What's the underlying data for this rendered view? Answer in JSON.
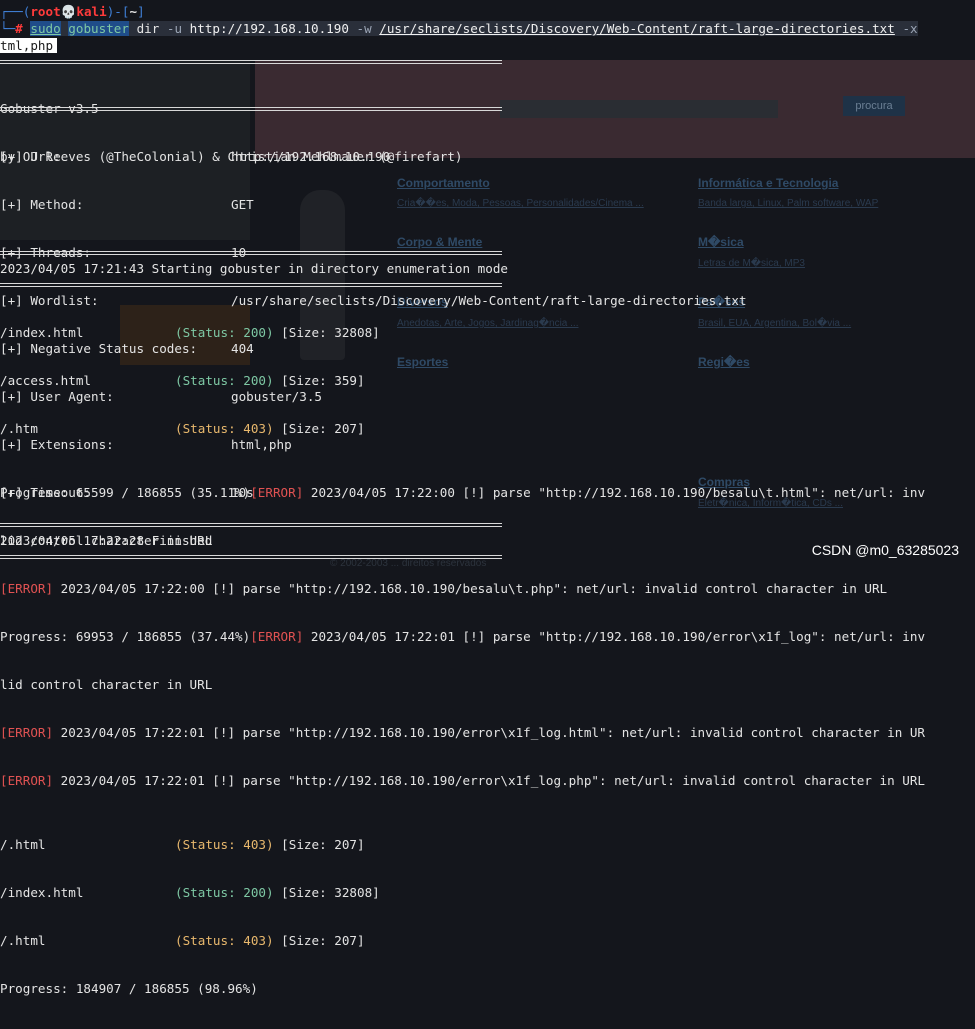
{
  "prompt": {
    "user": "root",
    "skull": "💀",
    "host": "kali",
    "dir": "~",
    "symbol": "#"
  },
  "command": {
    "sudo": "sudo",
    "tool": "gobuster",
    "mode": "dir",
    "url_flag": "-u",
    "url": "http://192.168.10.190",
    "wordlist_flag": "-w",
    "wordlist": "/usr/share/seclists/Discovery/Web-Content/raft-large-directories.txt",
    "ext_flag": "-x",
    "ext_continued": "tml,php"
  },
  "banner": {
    "version": "Gobuster v3.5",
    "credits": "by OJ Reeves (@TheColonial) & Christian Mehlmauer (@firefart)"
  },
  "config": [
    {
      "key": "[+] Url:",
      "value": "http://192.168.10.190"
    },
    {
      "key": "[+] Method:",
      "value": "GET"
    },
    {
      "key": "[+] Threads:",
      "value": "10"
    },
    {
      "key": "[+] Wordlist:",
      "value": "/usr/share/seclists/Discovery/Web-Content/raft-large-directories.txt"
    },
    {
      "key": "[+] Negative Status codes:",
      "value": "404"
    },
    {
      "key": "[+] User Agent:",
      "value": "gobuster/3.5"
    },
    {
      "key": "[+] Extensions:",
      "value": "html,php"
    },
    {
      "key": "[+] Timeout:",
      "value": "10s"
    }
  ],
  "start_line": "2023/04/05 17:21:43 Starting gobuster in directory enumeration mode",
  "results_1": [
    {
      "path": "/index.html",
      "status": "(Status: 200)",
      "code": 200,
      "size": "[Size: 32808]"
    },
    {
      "path": "/access.html",
      "status": "(Status: 200)",
      "code": 200,
      "size": "[Size: 359]"
    },
    {
      "path": "/.htm",
      "status": "(Status: 403)",
      "code": 403,
      "size": "[Size: 207]"
    }
  ],
  "log": {
    "progress1": "Progress: 65599 / 186855 (35.11%)",
    "err_tag": "[ERROR]",
    "err1_rest": " 2023/04/05 17:22:00 [!] parse \"http://192.168.10.190/besalu\\t.html\": net/url: inv",
    "err1_wrap": "lid control character in URL",
    "err2_rest": " 2023/04/05 17:22:00 [!] parse \"http://192.168.10.190/besalu\\t.php\": net/url: invalid control character in URL",
    "progress2": "Progress: 69953 / 186855 (37.44%)",
    "err3_rest": " 2023/04/05 17:22:01 [!] parse \"http://192.168.10.190/error\\x1f_log\": net/url: inv",
    "err3_wrap": "lid control character in URL",
    "err4_rest": " 2023/04/05 17:22:01 [!] parse \"http://192.168.10.190/error\\x1f_log.html\": net/url: invalid control character in UR",
    "err5_rest": " 2023/04/05 17:22:01 [!] parse \"http://192.168.10.190/error\\x1f_log.php\": net/url: invalid control character in URL"
  },
  "results_2": [
    {
      "path": "/.html",
      "status": "(Status: 403)",
      "code": 403,
      "size": "[Size: 207]"
    },
    {
      "path": "/index.html",
      "status": "(Status: 200)",
      "code": 200,
      "size": "[Size: 32808]"
    },
    {
      "path": "/.html",
      "status": "(Status: 403)",
      "code": 403,
      "size": "[Size: 207]"
    }
  ],
  "progress_final": "Progress: 184907 / 186855 (98.96%)",
  "finished_line": "2023/04/05 17:22:28 Finished",
  "background_page": {
    "search_button": "procura",
    "categories": [
      "Comportamento",
      "Informática e Tecnologia",
      "Corpo & Mente",
      "M�sica",
      "Diversos",
      "Pa�ses",
      "Esportes",
      "Regi�es",
      "Compras"
    ],
    "subs": [
      "Cria��es, Moda, Pessoas, Personalidades/Cinema ...",
      "Banda larga, Linux, Palm software, WAP",
      "Letras de M�sica, MP3",
      "Anedotas, Arte, Jogos, Jardinag�ncia ...",
      "Brasil, EUA, Argentina, Bol�via ...",
      "Eletr�nica, Inform�tica, CDs ..."
    ],
    "footer": "© 2002-2003 ... direitos reservados"
  },
  "watermark": "CSDN @m0_63285023",
  "colors": {
    "status_ok": "#7ec8a4",
    "status_forbidden": "#e8b86d",
    "error": "#e05252",
    "prompt_user": "#ff3b3b",
    "prompt_frame": "#3f7fd6"
  }
}
